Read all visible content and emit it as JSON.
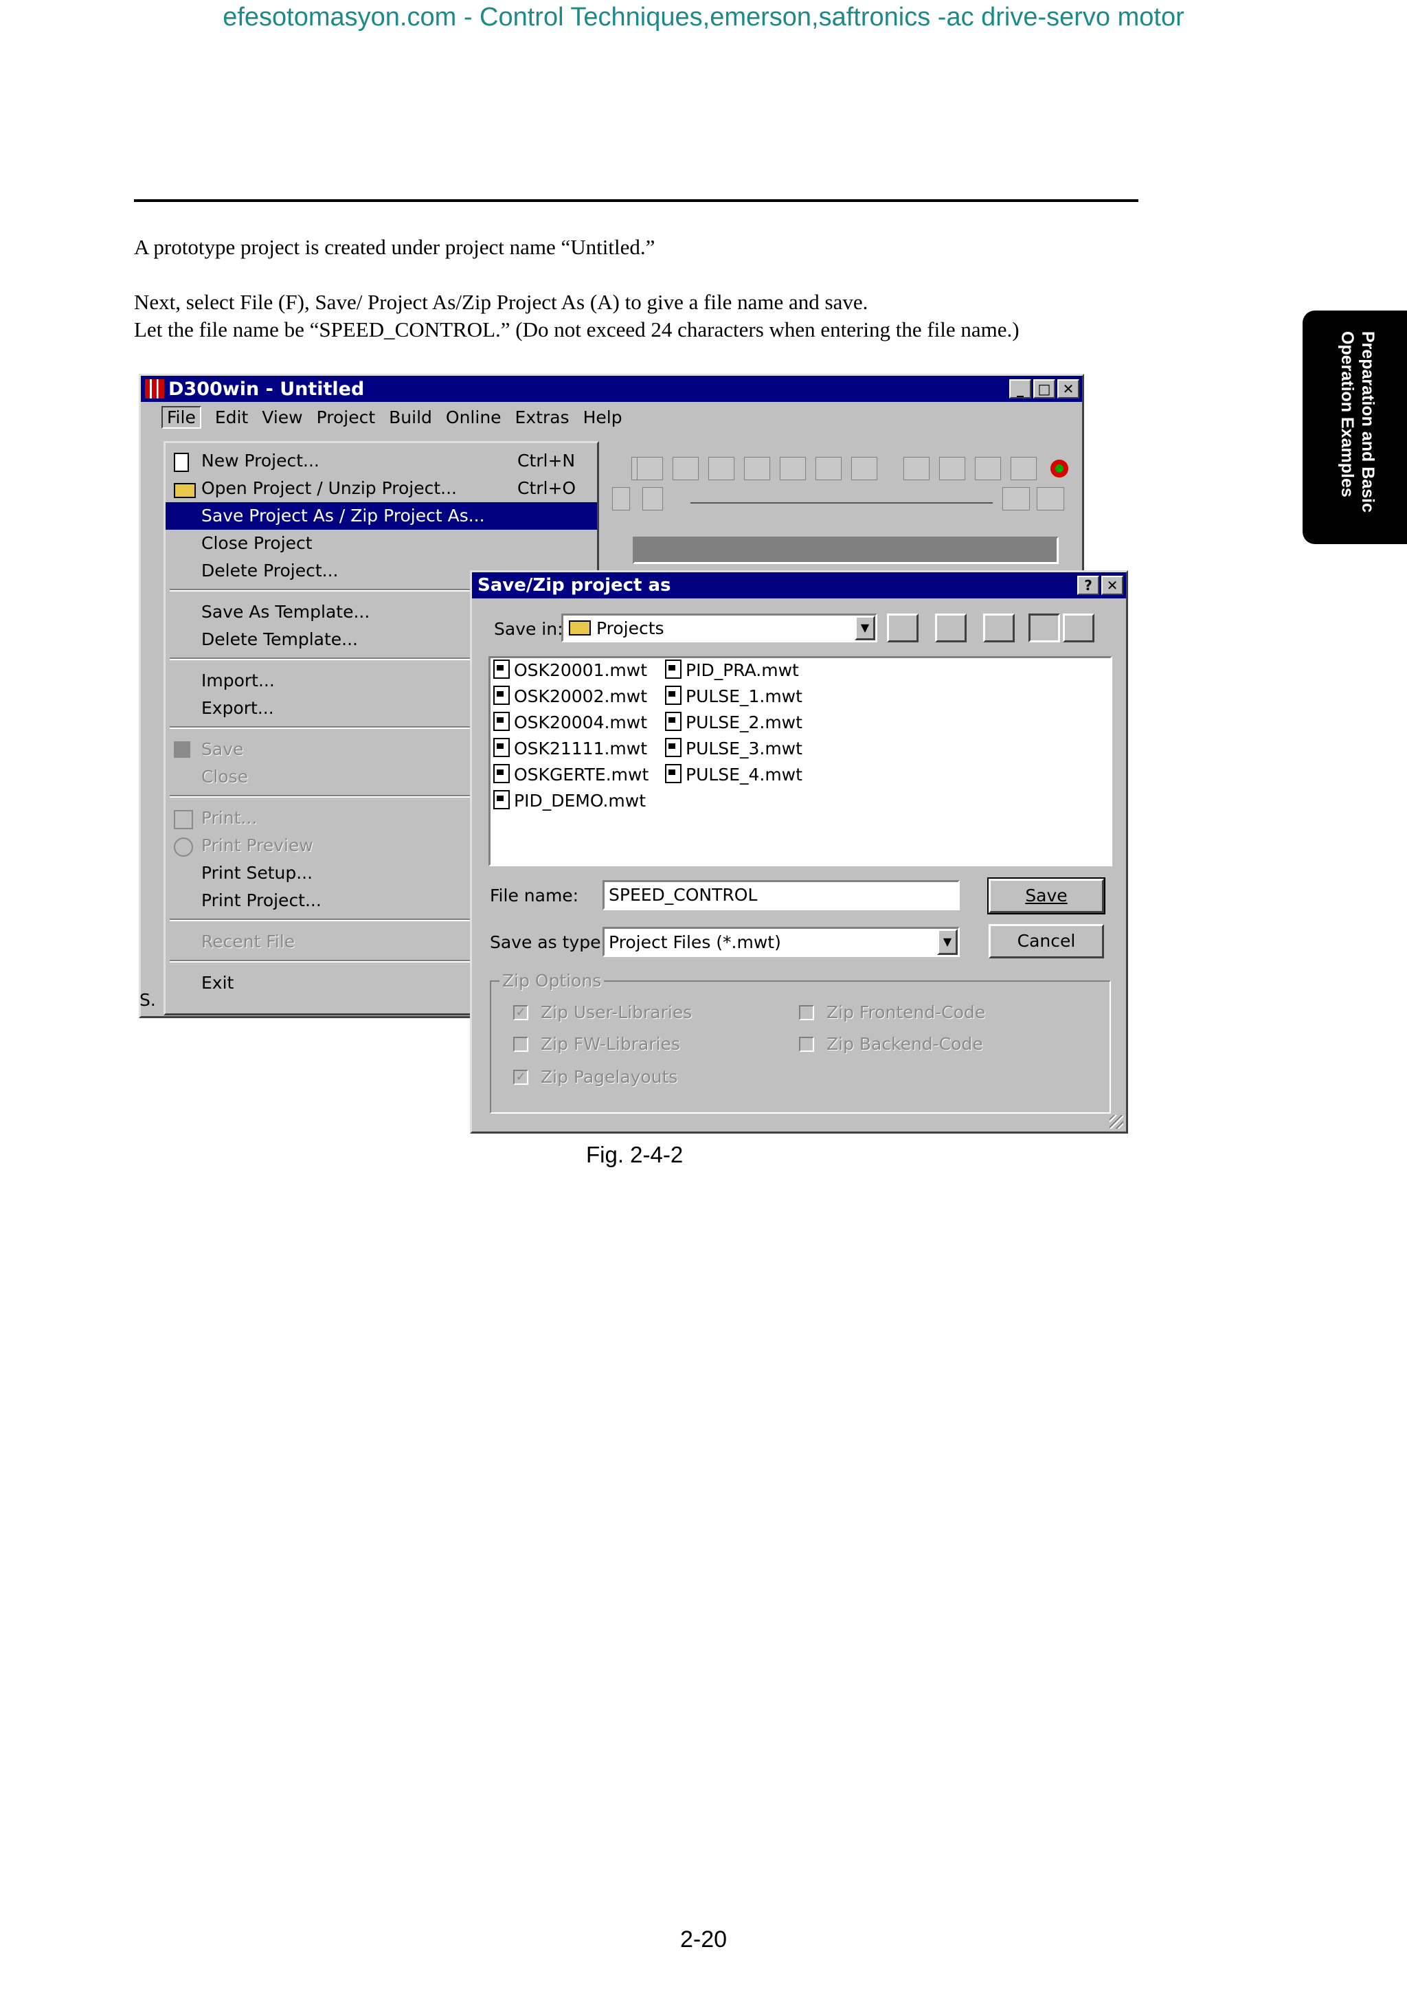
{
  "header_link": "efesotomasyon.com - Control Techniques,emerson,saftronics -ac drive-servo motor",
  "paragraphs": {
    "p1": "A prototype project is created under project name “Untitled.”",
    "p2": "Next, select File (F), Save/ Project As/Zip Project As (A) to give a file name and save.",
    "p3": "Let the file name be “SPEED_CONTROL.” (Do not exceed 24 characters when entering the file name.)"
  },
  "side_tab": {
    "line1": "Preparation and Basic",
    "line2": "Operation Examples"
  },
  "app_window": {
    "title": "D300win - Untitled",
    "menus": [
      "File",
      "Edit",
      "View",
      "Project",
      "Build",
      "Online",
      "Extras",
      "Help"
    ],
    "status_fragment": "S."
  },
  "file_menu": {
    "items": [
      {
        "label": "New Project...",
        "shortcut": "Ctrl+N",
        "icon": "new-page-icon"
      },
      {
        "label": "Open Project / Unzip Project...",
        "shortcut": "Ctrl+O",
        "icon": "open-folder-icon"
      },
      {
        "label": "Save Project As / Zip Project As...",
        "shortcut": "",
        "selected": true
      },
      {
        "label": "Close Project"
      },
      {
        "label": "Delete Project..."
      },
      {
        "label": "Save As Template..."
      },
      {
        "label": "Delete Template..."
      },
      {
        "label": "Import..."
      },
      {
        "label": "Export..."
      },
      {
        "label": "Save",
        "disabled": true,
        "icon": "floppy-disk-icon"
      },
      {
        "label": "Close",
        "disabled": true
      },
      {
        "label": "Print...",
        "disabled": true,
        "icon": "printer-icon"
      },
      {
        "label": "Print Preview",
        "disabled": true,
        "icon": "print-preview-icon"
      },
      {
        "label": "Print Setup..."
      },
      {
        "label": "Print Project..."
      },
      {
        "label": "Recent File",
        "disabled": true
      },
      {
        "label": "Exit"
      }
    ]
  },
  "dialog": {
    "title": "Save/Zip project as",
    "save_in_label": "Save in:",
    "save_in_value": "Projects",
    "files_col1": [
      "OSK20001.mwt",
      "OSK20002.mwt",
      "OSK20004.mwt",
      "OSK21111.mwt",
      "OSKGERTE.mwt",
      "PID_DEMO.mwt"
    ],
    "files_col2": [
      "PID_PRA.mwt",
      "PULSE_1.mwt",
      "PULSE_2.mwt",
      "PULSE_3.mwt",
      "PULSE_4.mwt"
    ],
    "file_name_label": "File name:",
    "file_name_value": "SPEED_CONTROL",
    "save_type_label": "Save as type:",
    "save_type_value": "Project Files (*.mwt)",
    "save_button": "Save",
    "cancel_button": "Cancel",
    "zip_group_label": "Zip Options",
    "options": [
      {
        "label": "Zip User-Libraries",
        "checked": true
      },
      {
        "label": "Zip FW-Libraries",
        "checked": false
      },
      {
        "label": "Zip Pagelayouts",
        "checked": true
      },
      {
        "label": "Zip Frontend-Code",
        "checked": false
      },
      {
        "label": "Zip Backend-Code",
        "checked": false
      }
    ]
  },
  "figure_caption": "Fig. 2-4-2",
  "page_number": "2-20"
}
